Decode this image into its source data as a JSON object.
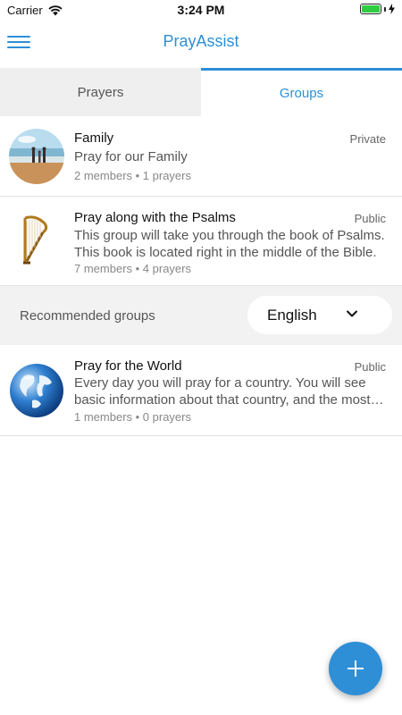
{
  "status_bar": {
    "carrier": "Carrier",
    "time": "3:24 PM",
    "battery_level": 1.0
  },
  "nav": {
    "title": "PrayAssist",
    "menu_icon": "hamburger-icon"
  },
  "tabs": [
    {
      "label": "Prayers",
      "active": false
    },
    {
      "label": "Groups",
      "active": true
    }
  ],
  "my_groups": [
    {
      "title": "Family",
      "visibility": "Private",
      "description": "Pray for our Family",
      "meta": "2 members • 1 prayers",
      "avatar_icon": "beach-family-photo"
    },
    {
      "title": "Pray along with the Psalms",
      "visibility": "Public",
      "description": "This group will take you through the book of Psalms. This book is located right in the middle of the Bible.",
      "meta": "7 members • 4 prayers",
      "avatar_icon": "harp-icon"
    }
  ],
  "recommended": {
    "label": "Recommended groups",
    "language": "English",
    "chevron_icon": "chevron-down-icon"
  },
  "recommended_groups": [
    {
      "title": "Pray for the World",
      "visibility": "Public",
      "description": "Every day you will pray for a country. You will see basic information about that country, and the most important prayer needs.",
      "meta": "1 members • 0 prayers",
      "avatar_icon": "globe-icon"
    }
  ],
  "fab": {
    "icon": "plus-icon"
  },
  "colors": {
    "accent": "#2e8fd6",
    "tab_inactive_bg": "#efefef",
    "strip_bg": "#f2f2f2",
    "battery": "#2ecc40"
  }
}
